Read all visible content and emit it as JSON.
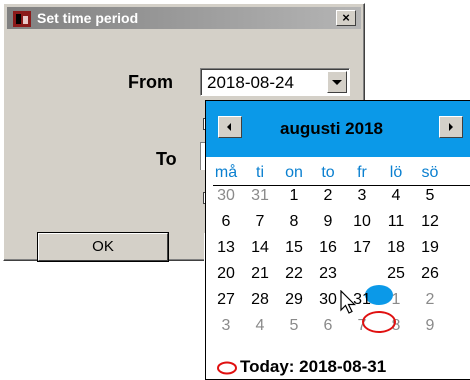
{
  "dialog": {
    "title": "Set time period",
    "close_glyph": "×",
    "from_label": "From",
    "to_label": "To",
    "from_value": "2018-08-24",
    "ok_label": "OK"
  },
  "calendar": {
    "month_title": "augusti 2018",
    "weekdays": [
      "må",
      "ti",
      "on",
      "to",
      "fr",
      "lö",
      "sö"
    ],
    "weeks": [
      [
        {
          "d": "30",
          "o": true
        },
        {
          "d": "31",
          "o": true
        },
        {
          "d": "1"
        },
        {
          "d": "2"
        },
        {
          "d": "3"
        },
        {
          "d": "4"
        },
        {
          "d": "5"
        }
      ],
      [
        {
          "d": "6"
        },
        {
          "d": "7"
        },
        {
          "d": "8"
        },
        {
          "d": "9"
        },
        {
          "d": "10"
        },
        {
          "d": "11"
        },
        {
          "d": "12"
        }
      ],
      [
        {
          "d": "13"
        },
        {
          "d": "14"
        },
        {
          "d": "15"
        },
        {
          "d": "16"
        },
        {
          "d": "17"
        },
        {
          "d": "18"
        },
        {
          "d": "19"
        }
      ],
      [
        {
          "d": "20"
        },
        {
          "d": "21"
        },
        {
          "d": "22"
        },
        {
          "d": "23"
        },
        {
          "d": "24",
          "sel": true
        },
        {
          "d": "25"
        },
        {
          "d": "26"
        }
      ],
      [
        {
          "d": "27"
        },
        {
          "d": "28"
        },
        {
          "d": "29"
        },
        {
          "d": "30"
        },
        {
          "d": "31",
          "today": true
        },
        {
          "d": "1",
          "o": true
        },
        {
          "d": "2",
          "o": true
        }
      ],
      [
        {
          "d": "3",
          "o": true
        },
        {
          "d": "4",
          "o": true
        },
        {
          "d": "5",
          "o": true
        },
        {
          "d": "6",
          "o": true
        },
        {
          "d": "7",
          "o": true
        },
        {
          "d": "8",
          "o": true
        },
        {
          "d": "9",
          "o": true
        }
      ]
    ],
    "today_text": "Today: 2018-08-31"
  },
  "colors": {
    "accent": "#0b99e8",
    "today_ring": "#e01010",
    "weekday_text": "#0b80d0"
  }
}
